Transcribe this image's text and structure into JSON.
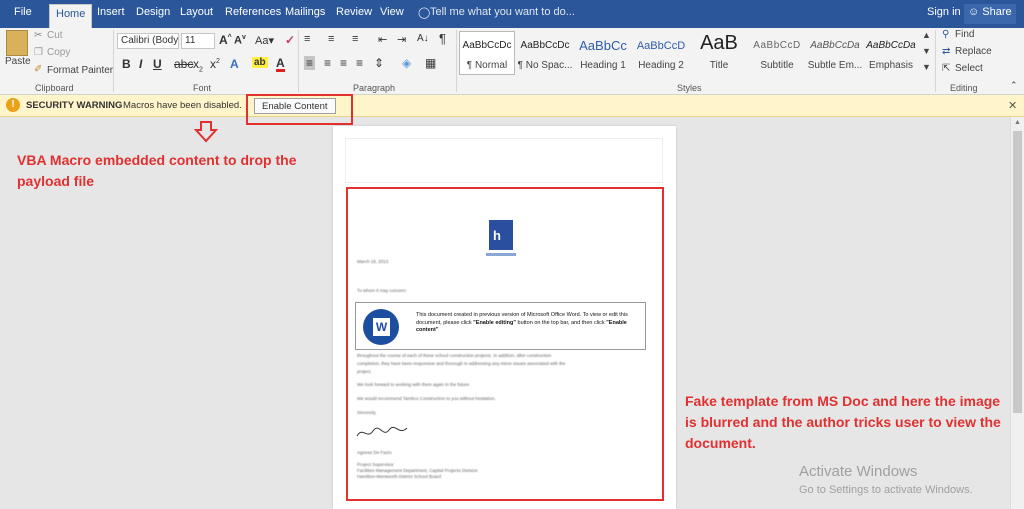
{
  "tabs": {
    "file": "File",
    "home": "Home",
    "insert": "Insert",
    "design": "Design",
    "layout": "Layout",
    "references": "References",
    "mailings": "Mailings",
    "review": "Review",
    "view": "View",
    "tell_me": "Tell me what you want to do...",
    "sign_in": "Sign in",
    "share": "Share"
  },
  "clipboard": {
    "paste": "Paste",
    "cut": "Cut",
    "copy": "Copy",
    "format_painter": "Format Painter",
    "label": "Clipboard"
  },
  "font": {
    "family": "Calibri (Body)",
    "size": "11",
    "label": "Font"
  },
  "paragraph": {
    "label": "Paragraph"
  },
  "styles": {
    "label": "Styles",
    "items": [
      {
        "preview": "AaBbCcDc",
        "name": "¶ Normal"
      },
      {
        "preview": "AaBbCcDc",
        "name": "¶ No Spac..."
      },
      {
        "preview": "AaBbCc",
        "name": "Heading 1"
      },
      {
        "preview": "AaBbCcD",
        "name": "Heading 2"
      },
      {
        "preview": "AaB",
        "name": "Title"
      },
      {
        "preview": "AaBbCcD",
        "name": "Subtitle"
      },
      {
        "preview": "AaBbCcDa",
        "name": "Subtle Em..."
      },
      {
        "preview": "AaBbCcDa",
        "name": "Emphasis"
      }
    ]
  },
  "editing": {
    "find": "Find",
    "replace": "Replace",
    "select": "Select",
    "label": "Editing"
  },
  "security": {
    "title": "SECURITY WARNING",
    "message": "Macros have been disabled.",
    "button": "Enable Content"
  },
  "annotations": {
    "left": "VBA Macro embedded content to drop the payload file",
    "right": "Fake template from MS Doc and here the image is blurred and the author tricks user to view the document."
  },
  "doc": {
    "date": "March 19, 2013",
    "greeting": "To whom it may concern:",
    "notice_pre": "This document created in previous version of Microsoft Office Word. To view or edit this document, please click ",
    "notice_b1": "\"Enable editing\"",
    "notice_mid": " button on the top bar, and then click ",
    "notice_b2": "\"Enable content\"",
    "p1": "throughout the course of each of these school construction projects. In addition, after construction",
    "p2": "completion, they have been responsive and thorough in addressing any minor issues associated with the",
    "p3": "project.",
    "p4": "We look forward to working with them again in the future.",
    "p5": "We would recommend Tambco Construction to you without hesitation.",
    "p6": "Sincerely,",
    "sign_name": "Agnese De Fazio",
    "sign_title": "Project Supervisor",
    "sign_dept": "Facilities Management Department, Capital Projects Division",
    "sign_board": "Hamilton-Wentworth District School Board"
  },
  "watermark": {
    "title": "Activate Windows",
    "sub": "Go to Settings to activate Windows."
  },
  "colors": {
    "brand": "#2b579a",
    "annotation": "#e0302f",
    "warning_bar": "#fff4ca"
  }
}
